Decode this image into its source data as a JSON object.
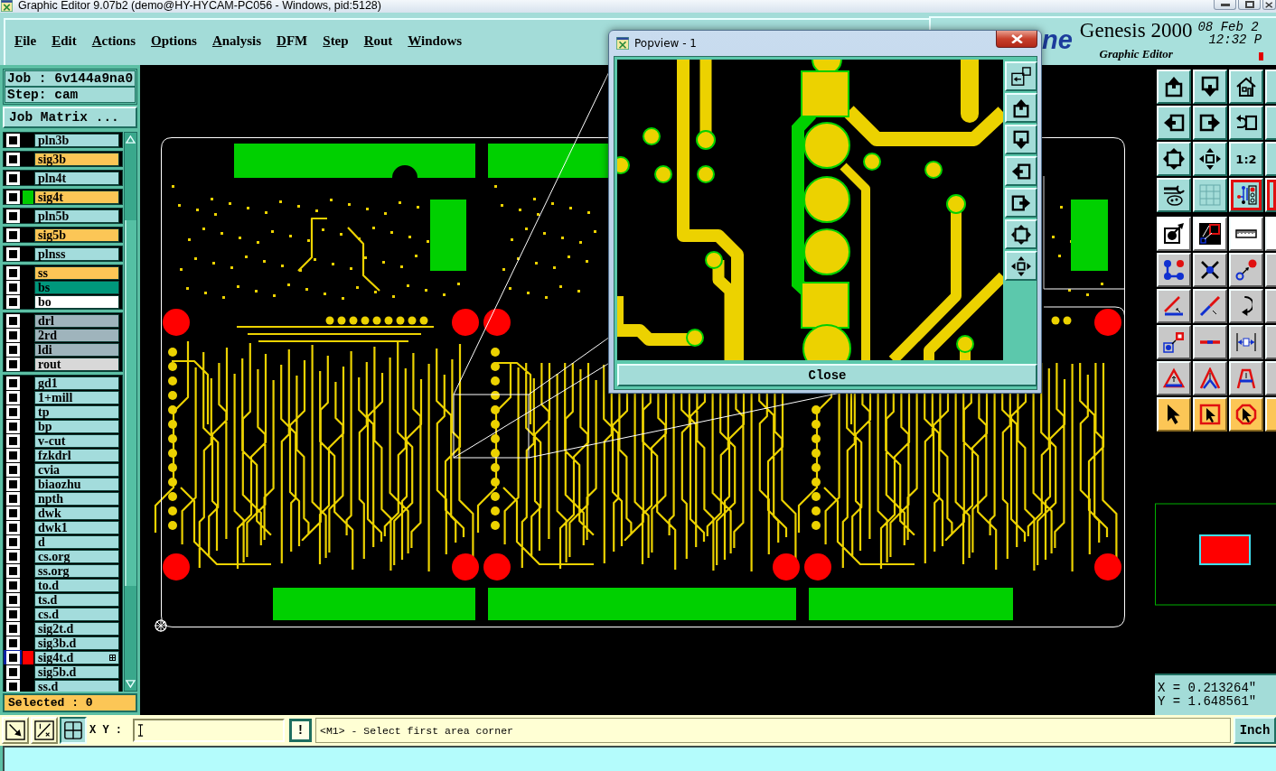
{
  "window": {
    "title": "Graphic Editor 9.07b2 (demo@HY-HYCAM-PC056 - Windows, pid:5128)"
  },
  "menu": [
    "File",
    "Edit",
    "Actions",
    "Options",
    "Analysis",
    "DFM",
    "Step",
    "Rout",
    "Windows"
  ],
  "brand": {
    "logo_fragment": "ne",
    "product": "Genesis 2000",
    "subtitle": "Graphic Editor",
    "date": "08 Feb 2",
    "time": "12:32 P"
  },
  "job": {
    "job": "Job : 6v144a9na0",
    "step": "Step: cam",
    "matrix_button": "Job Matrix ..."
  },
  "layer_groups": [
    {
      "layers": [
        {
          "name": "pln3b",
          "color": "#a3dcdc",
          "checked": false,
          "work": false
        }
      ]
    },
    {
      "layers": [
        {
          "name": "sig3b",
          "color": "#fcc656",
          "checked": false,
          "work": false
        }
      ]
    },
    {
      "layers": [
        {
          "name": "pln4t",
          "color": "#a3dcdc",
          "checked": false,
          "work": false
        }
      ]
    },
    {
      "layers": [
        {
          "name": "sig4t",
          "color": "#fcc656",
          "swatch": {
            "color": "#00cc00"
          },
          "checked": false,
          "work": false
        }
      ]
    },
    {
      "layers": [
        {
          "name": "pln5b",
          "color": "#a3dcdc",
          "checked": false,
          "work": false
        }
      ]
    },
    {
      "layers": [
        {
          "name": "sig5b",
          "color": "#fcc656",
          "checked": false,
          "work": false
        }
      ]
    },
    {
      "layers": [
        {
          "name": "plnss",
          "color": "#a3dcdc",
          "checked": false,
          "work": false
        }
      ]
    },
    {
      "layers": [
        {
          "name": "ss",
          "color": "#fcc656",
          "checked": false,
          "work": false
        },
        {
          "name": "bs",
          "color": "#00987c",
          "checked": false,
          "work": false
        },
        {
          "name": "bo",
          "color": "#ffffff",
          "checked": false,
          "work": false
        }
      ]
    },
    {
      "layers": [
        {
          "name": "drl",
          "color": "#9fb4bc",
          "checked": false,
          "work": false
        },
        {
          "name": "2rd",
          "color": "#9fb4bc",
          "checked": false,
          "work": false
        },
        {
          "name": "ldi",
          "color": "#9fb4bc",
          "checked": false,
          "work": false
        },
        {
          "name": "rout",
          "color": "#d8d8d8",
          "checked": false,
          "work": false
        }
      ]
    },
    {
      "layers": [
        {
          "name": "gd1",
          "color": "#a3dcdc",
          "checked": false,
          "work": false
        },
        {
          "name": "1+mill",
          "color": "#a3dcdc",
          "checked": false,
          "work": false
        },
        {
          "name": "tp",
          "color": "#a3dcdc",
          "checked": false,
          "work": false
        },
        {
          "name": "bp",
          "color": "#a3dcdc",
          "checked": false,
          "work": false
        },
        {
          "name": "v-cut",
          "color": "#a3dcdc",
          "checked": false,
          "work": false
        },
        {
          "name": "fzkdrl",
          "color": "#a3dcdc",
          "checked": false,
          "work": false
        },
        {
          "name": "cvia",
          "color": "#a3dcdc",
          "checked": false,
          "work": false
        },
        {
          "name": "biaozhu",
          "color": "#a3dcdc",
          "checked": false,
          "work": false
        },
        {
          "name": "npth",
          "color": "#a3dcdc",
          "checked": false,
          "work": false
        },
        {
          "name": "dwk",
          "color": "#a3dcdc",
          "checked": false,
          "work": false
        },
        {
          "name": "dwk1",
          "color": "#a3dcdc",
          "checked": false,
          "work": false
        },
        {
          "name": "d",
          "color": "#a3dcdc",
          "checked": false,
          "work": false
        },
        {
          "name": "cs.org",
          "color": "#a3dcdc",
          "checked": false,
          "work": false
        },
        {
          "name": "ss.org",
          "color": "#a3dcdc",
          "checked": false,
          "work": false
        },
        {
          "name": "to.d",
          "color": "#a3dcdc",
          "checked": false,
          "work": false
        },
        {
          "name": "ts.d",
          "color": "#a3dcdc",
          "checked": false,
          "work": false
        },
        {
          "name": "cs.d",
          "color": "#a3dcdc",
          "checked": false,
          "work": false
        },
        {
          "name": "sig2t.d",
          "color": "#a3dcdc",
          "checked": false,
          "work": false
        },
        {
          "name": "sig3b.d",
          "color": "#a3dcdc",
          "checked": false,
          "work": false
        },
        {
          "name": "sig4t.d",
          "color": "#a3dcdc",
          "swatch": {
            "color": "#ff0000"
          },
          "checked": false,
          "work": true
        },
        {
          "name": "sig5b.d",
          "color": "#a3dcdc",
          "checked": false,
          "work": false
        },
        {
          "name": "ss.d",
          "color": "#a3dcdc",
          "checked": false,
          "work": false
        }
      ]
    }
  ],
  "selected_count": "Selected : 0",
  "tool_rows": [
    {
      "kind": "view",
      "buttons": [
        {
          "on": false
        },
        {
          "on": false
        },
        {
          "on": false
        },
        {
          "on": false
        }
      ]
    },
    {
      "kind": "view",
      "buttons": [
        {
          "on": false
        },
        {
          "on": false
        },
        {
          "on": false
        },
        {
          "on": false
        }
      ]
    },
    {
      "kind": "view",
      "buttons": [
        {
          "on": false
        },
        {
          "on": false
        },
        {
          "label": "1:2",
          "on": false
        },
        {
          "on": false
        }
      ]
    },
    {
      "kind": "view",
      "buttons": [
        {
          "on": false
        },
        {
          "on": false
        },
        {
          "on": true
        },
        {
          "on": true
        }
      ]
    },
    {
      "kind": "measure",
      "buttons": [
        {
          "on": false
        },
        {
          "on": false
        },
        {
          "on": false
        },
        {
          "on": false
        }
      ]
    },
    {
      "kind": "edit",
      "buttons": [
        {
          "on": false
        },
        {
          "on": false
        },
        {
          "on": false
        },
        {
          "on": false
        }
      ]
    },
    {
      "kind": "edit",
      "buttons": [
        {
          "on": false
        },
        {
          "on": false
        },
        {
          "on": false
        },
        {
          "on": false
        }
      ]
    },
    {
      "kind": "edit",
      "buttons": [
        {
          "on": false
        },
        {
          "on": false
        },
        {
          "on": false
        },
        {
          "on": false
        }
      ]
    },
    {
      "kind": "edit",
      "buttons": [
        {
          "on": false
        },
        {
          "on": false
        },
        {
          "on": false
        },
        {
          "on": false
        }
      ]
    },
    {
      "kind": "select",
      "buttons": [
        {
          "on": false
        },
        {
          "on": false
        },
        {
          "on": false
        },
        {
          "on": false
        }
      ]
    }
  ],
  "coordinates": {
    "x": "X = 0.213264\"",
    "y": "Y = 1.648561\""
  },
  "command_bar": {
    "tools": [
      {
        "selected": false
      },
      {
        "selected": false
      },
      {
        "selected": true
      }
    ],
    "xy_label": "X Y :",
    "alert_button": "!",
    "message": "<M1> - Select first area corner",
    "units_button": "Inch"
  },
  "popview": {
    "title": "Popview - 1",
    "close_button": "Close"
  }
}
